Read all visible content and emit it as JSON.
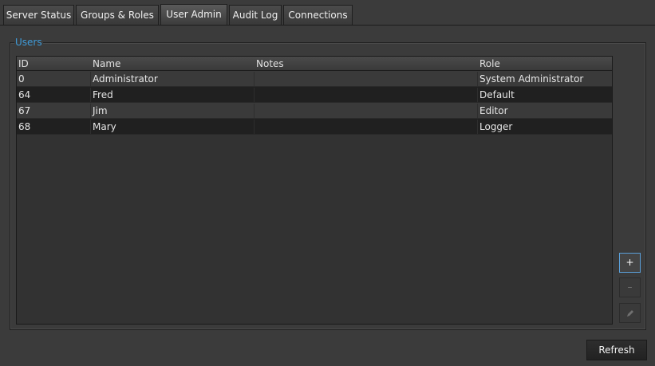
{
  "tabs": [
    {
      "label": "Server Status",
      "active": false
    },
    {
      "label": "Groups & Roles",
      "active": false
    },
    {
      "label": "User Admin",
      "active": true
    },
    {
      "label": "Audit Log",
      "active": false
    },
    {
      "label": "Connections",
      "active": false
    }
  ],
  "users_panel": {
    "title": "Users",
    "columns": [
      "ID",
      "Name",
      "Notes",
      "Role"
    ],
    "rows": [
      {
        "id": "0",
        "name": "Administrator",
        "notes": "",
        "role": "System Administrator"
      },
      {
        "id": "64",
        "name": "Fred",
        "notes": "",
        "role": "Default"
      },
      {
        "id": "67",
        "name": "Jim",
        "notes": "",
        "role": "Editor"
      },
      {
        "id": "68",
        "name": "Mary",
        "notes": "",
        "role": "Logger"
      }
    ]
  },
  "side_buttons": {
    "add": "+",
    "remove": "–",
    "edit_icon": "pencil-icon"
  },
  "footer": {
    "refresh_label": "Refresh"
  },
  "colors": {
    "accent": "#3f9bd8",
    "background": "#3b3b3b"
  }
}
